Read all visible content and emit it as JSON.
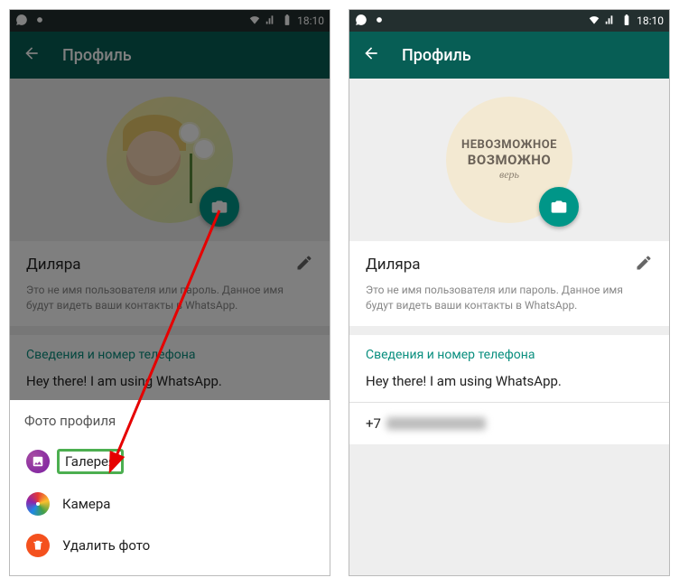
{
  "statusbar": {
    "time": "18:10"
  },
  "appbar": {
    "title": "Профиль"
  },
  "profile": {
    "name": "Диляра",
    "hint": "Это не имя пользователя или пароль. Данное имя будут видеть ваши контакты в WhatsApp.",
    "section_header": "Сведения и номер телефона",
    "status": "Hey there! I am using WhatsApp.",
    "phone_prefix": "+7"
  },
  "avatar_right": {
    "line1": "НЕВОЗМОЖНОЕ",
    "line2": "ВОЗМОЖНО",
    "line3": "верь"
  },
  "sheet": {
    "title": "Фото профиля",
    "gallery": "Галерея",
    "camera": "Камера",
    "delete": "Удалить фото"
  }
}
